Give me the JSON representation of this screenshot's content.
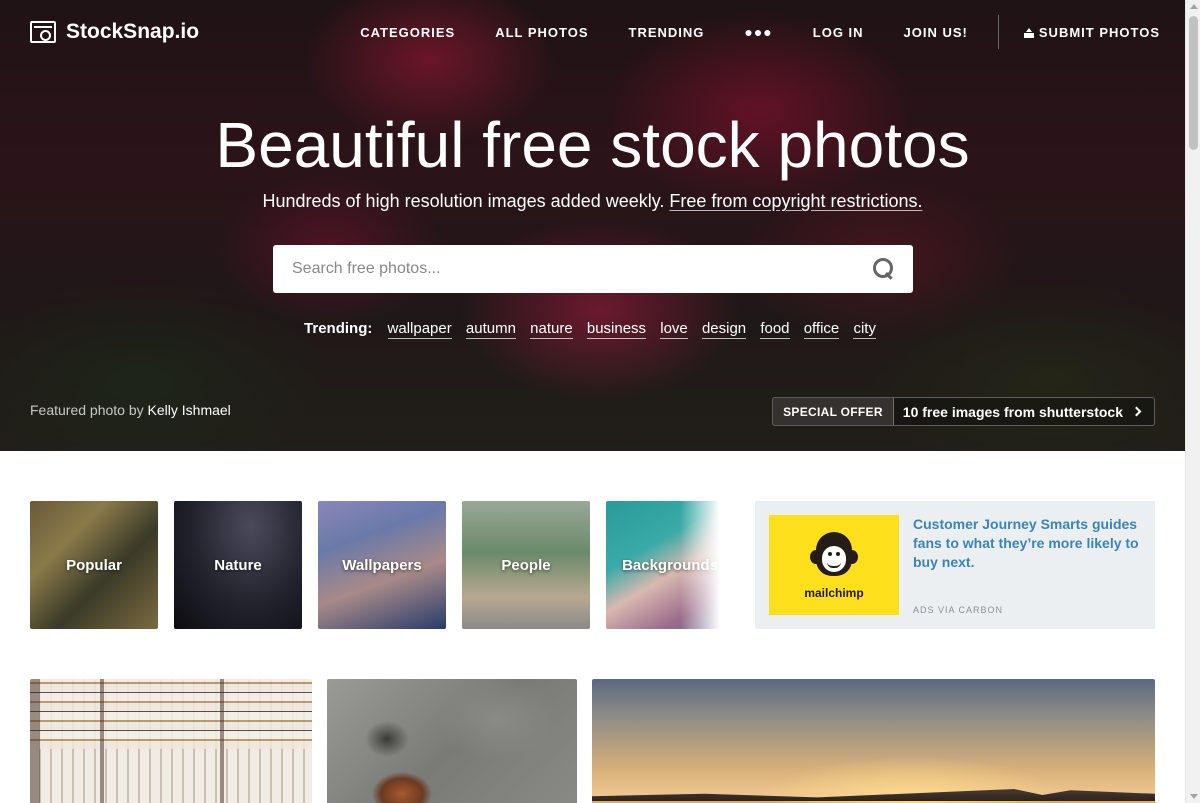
{
  "header": {
    "logo_text": "StockSnap.io",
    "nav": {
      "categories": "CATEGORIES",
      "all_photos": "ALL PHOTOS",
      "trending": "TRENDING",
      "more": "●●●",
      "log_in": "LOG IN",
      "join_us": "JOIN US!",
      "submit_photos": "SUBMIT PHOTOS"
    }
  },
  "hero": {
    "title": "Beautiful free stock photos",
    "subtitle_text": "Hundreds of high resolution images added weekly.",
    "subtitle_link": "Free from copyright restrictions.",
    "search_placeholder": "Search free photos...",
    "trending_label": "Trending:",
    "trending_tags": [
      "wallpaper",
      "autumn",
      "nature",
      "business",
      "love",
      "design",
      "food",
      "office",
      "city"
    ],
    "credit_prefix": "Featured photo by",
    "credit_name": "Kelly Ishmael",
    "offer_tag": "SPECIAL OFFER",
    "offer_text": "10 free images from shutterstock"
  },
  "categories": [
    "Popular",
    "Nature",
    "Wallpapers",
    "People",
    "Backgrounds"
  ],
  "ad": {
    "brand": "mailchimp",
    "text": "Customer Journey Smarts guides fans to what they’re more likely to buy next.",
    "via": "ADS VIA CARBON",
    "brand_color": "#ffe01b",
    "link_color": "#3a84b8"
  },
  "icons": {
    "logo": "camera-icon",
    "search": "search-icon",
    "upload": "upload-icon",
    "offer_arrow": "chevron-right-icon"
  }
}
